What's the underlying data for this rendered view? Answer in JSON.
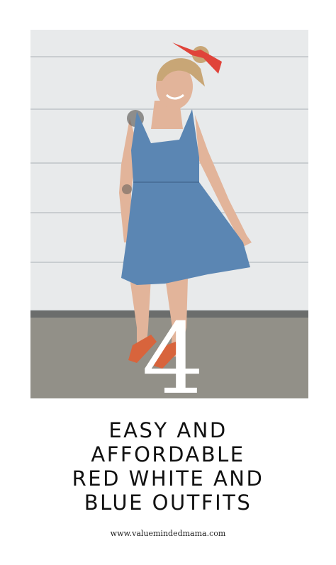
{
  "photo": {
    "number": "4",
    "colors": {
      "siding": "#e8eaeb",
      "siding_line": "#c9cdd0",
      "ground": "#8c8b84",
      "dress": "#5b86b3",
      "bow": "#e0443a",
      "sandals": "#d8643c",
      "skin": "#e2b49a",
      "hair": "#c8a676"
    }
  },
  "headline": {
    "line1": "EASY AND",
    "line2": "AFFORDABLE",
    "line3": "RED WHITE AND",
    "line4": "BLUE OUTFITS"
  },
  "footer": {
    "site": "www.valuemindedmama.com"
  }
}
